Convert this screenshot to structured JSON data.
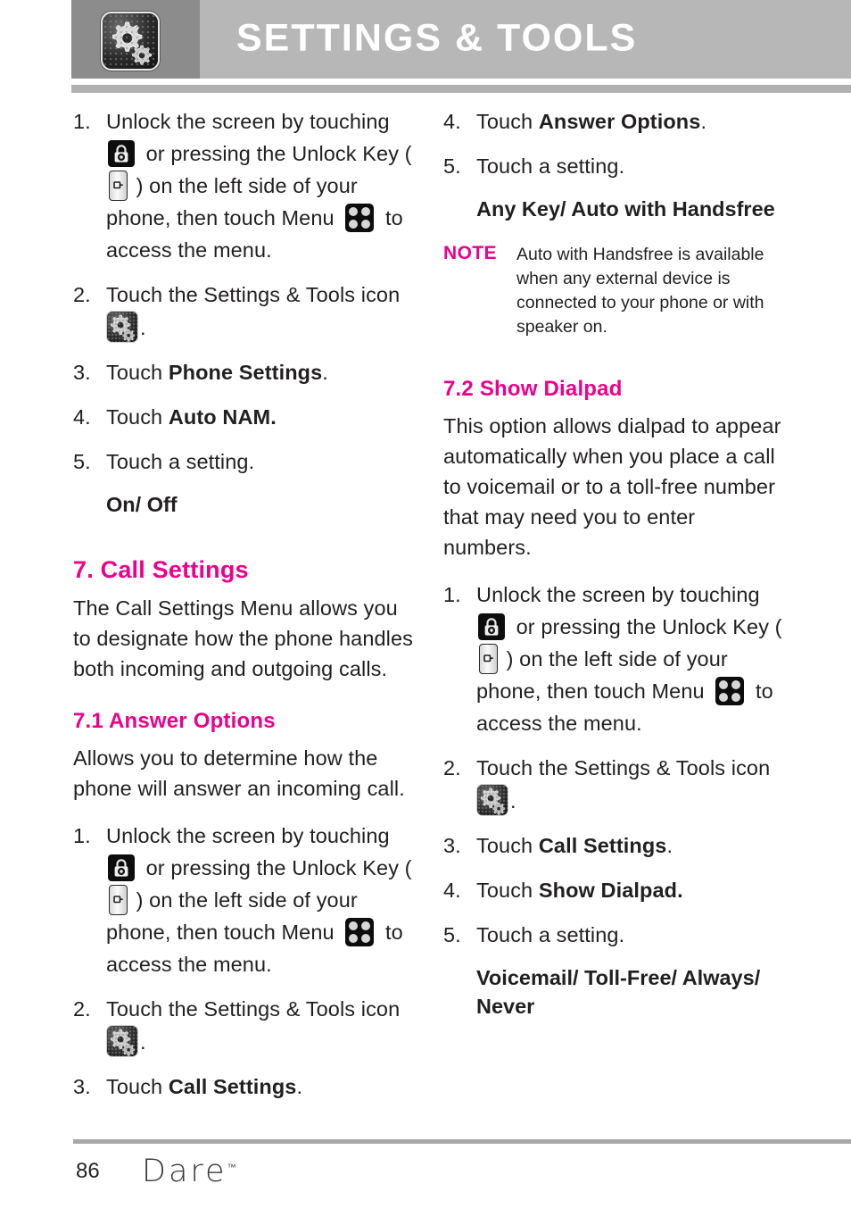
{
  "header": {
    "title": "SETTINGS & TOOLS",
    "icon": "settings-tools-gear-icon"
  },
  "colors": {
    "accent_magenta": "#ec008c",
    "header_band": "#b7b7b7",
    "header_icon_block": "#8c8c8c",
    "rule_gray": "#b0b0b0",
    "text": "#231f20"
  },
  "left_column": {
    "steps_auto_nam": [
      {
        "num": "1.",
        "parts": [
          {
            "t": "text",
            "v": "Unlock the screen by touching "
          },
          {
            "t": "icon",
            "v": "lock"
          },
          {
            "t": "text",
            "v": " or pressing the Unlock Key ( "
          },
          {
            "t": "icon",
            "v": "key"
          },
          {
            "t": "text",
            "v": " ) on the left side of your phone, then touch Menu "
          },
          {
            "t": "icon",
            "v": "menu"
          },
          {
            "t": "text",
            "v": " to access the menu."
          }
        ]
      },
      {
        "num": "2.",
        "parts": [
          {
            "t": "text",
            "v": "Touch the Settings & Tools icon "
          },
          {
            "t": "icon",
            "v": "gear"
          },
          {
            "t": "text",
            "v": "."
          }
        ]
      },
      {
        "num": "3.",
        "parts": [
          {
            "t": "text",
            "v": "Touch "
          },
          {
            "t": "bold",
            "v": "Phone Settings"
          },
          {
            "t": "text",
            "v": "."
          }
        ]
      },
      {
        "num": "4.",
        "parts": [
          {
            "t": "text",
            "v": "Touch "
          },
          {
            "t": "bold",
            "v": "Auto NAM."
          }
        ]
      },
      {
        "num": "5.",
        "parts": [
          {
            "t": "text",
            "v": "Touch a setting."
          }
        ]
      }
    ],
    "options_auto_nam": "On/ Off",
    "heading_call_settings": "7. Call Settings",
    "intro_call_settings": "The Call Settings Menu allows you to designate how the phone handles both incoming and outgoing calls.",
    "heading_answer_options": "7.1 Answer Options",
    "intro_answer_options": "Allows you to determine how the phone will answer an incoming call.",
    "steps_answer_options": [
      {
        "num": "1.",
        "parts": [
          {
            "t": "text",
            "v": "Unlock the screen by touching "
          },
          {
            "t": "icon",
            "v": "lock"
          },
          {
            "t": "text",
            "v": " or pressing the Unlock Key ( "
          },
          {
            "t": "icon",
            "v": "key"
          },
          {
            "t": "text",
            "v": " ) on the left side of your phone, then touch Menu "
          },
          {
            "t": "icon",
            "v": "menu"
          },
          {
            "t": "text",
            "v": " to access the menu."
          }
        ]
      },
      {
        "num": "2.",
        "parts": [
          {
            "t": "text",
            "v": "Touch the Settings & Tools icon "
          },
          {
            "t": "icon",
            "v": "gear"
          },
          {
            "t": "text",
            "v": "."
          }
        ]
      },
      {
        "num": "3.",
        "parts": [
          {
            "t": "text",
            "v": "Touch "
          },
          {
            "t": "bold",
            "v": "Call Settings"
          },
          {
            "t": "text",
            "v": "."
          }
        ]
      }
    ]
  },
  "right_column": {
    "steps_answer_options_cont": [
      {
        "num": "4.",
        "parts": [
          {
            "t": "text",
            "v": "Touch "
          },
          {
            "t": "bold",
            "v": "Answer Options"
          },
          {
            "t": "text",
            "v": "."
          }
        ]
      },
      {
        "num": "5.",
        "parts": [
          {
            "t": "text",
            "v": "Touch a setting."
          }
        ]
      }
    ],
    "options_answer_options": "Any Key/ Auto with Handsfree",
    "note": {
      "label": "NOTE",
      "text": "Auto with Handsfree is available when any external device is connected to your phone or with speaker on."
    },
    "heading_show_dialpad": "7.2 Show Dialpad",
    "intro_show_dialpad": "This option allows dialpad to appear automatically when you place a call to voicemail or to a toll-free number that may need you to enter numbers.",
    "steps_show_dialpad": [
      {
        "num": "1.",
        "parts": [
          {
            "t": "text",
            "v": "Unlock the screen by touching "
          },
          {
            "t": "icon",
            "v": "lock"
          },
          {
            "t": "text",
            "v": " or pressing the Unlock Key ( "
          },
          {
            "t": "icon",
            "v": "key"
          },
          {
            "t": "text",
            "v": " ) on the left side of your phone, then touch Menu "
          },
          {
            "t": "icon",
            "v": "menu"
          },
          {
            "t": "text",
            "v": " to access the menu."
          }
        ]
      },
      {
        "num": "2.",
        "parts": [
          {
            "t": "text",
            "v": "Touch the Settings & Tools icon "
          },
          {
            "t": "icon",
            "v": "gear"
          },
          {
            "t": "text",
            "v": "."
          }
        ]
      },
      {
        "num": "3.",
        "parts": [
          {
            "t": "text",
            "v": "Touch "
          },
          {
            "t": "bold",
            "v": "Call Settings"
          },
          {
            "t": "text",
            "v": "."
          }
        ]
      },
      {
        "num": "4.",
        "parts": [
          {
            "t": "text",
            "v": "Touch "
          },
          {
            "t": "bold",
            "v": "Show Dialpad."
          }
        ]
      },
      {
        "num": "5.",
        "parts": [
          {
            "t": "text",
            "v": "Touch a setting."
          }
        ]
      }
    ],
    "options_show_dialpad": "Voicemail/ Toll-Free/ Always/ Never"
  },
  "footer": {
    "page_number": "86",
    "wordmark": "Dare",
    "trademark": "™"
  }
}
